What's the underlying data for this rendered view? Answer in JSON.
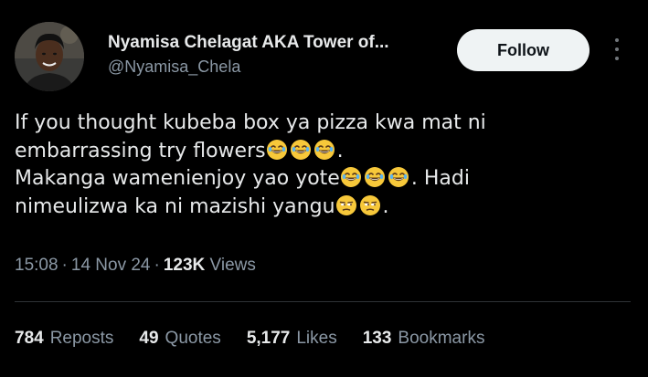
{
  "author": {
    "display_name": "Nyamisa Chelagat AKA Tower of...",
    "handle": "@Nyamisa_Chela",
    "avatar_icon": "profile-photo"
  },
  "follow_label": "Follow",
  "more_icon": "more-vertical-icon",
  "tweet": {
    "line1": "If you thought kubeba box ya pizza kwa mat ni",
    "line2_text": "embarrassing try flowers",
    "line2_end": ".",
    "line3_text": "Makanga wamenienjoy yao yote",
    "line3_end": ". Hadi",
    "line4_text": "nimeulizwa ka ni mazishi yangu",
    "line4_end": ".",
    "emoji": {
      "laughing": "grinning-squinting-face-emoji",
      "unamused": "unamused-face-emoji"
    }
  },
  "meta": {
    "time": "15:08",
    "date": "14 Nov 24",
    "views_count": "123K",
    "views_label": "Views",
    "separator": "·"
  },
  "stats": [
    {
      "value": "784",
      "label": "Reposts"
    },
    {
      "value": "49",
      "label": "Quotes"
    },
    {
      "value": "5,177",
      "label": "Likes"
    },
    {
      "value": "133",
      "label": "Bookmarks"
    }
  ],
  "colors": {
    "background": "#000000",
    "text_primary": "#e7e9ea",
    "text_secondary": "#8b98a5",
    "button_bg": "#eff3f4",
    "divider": "#2f3336"
  }
}
